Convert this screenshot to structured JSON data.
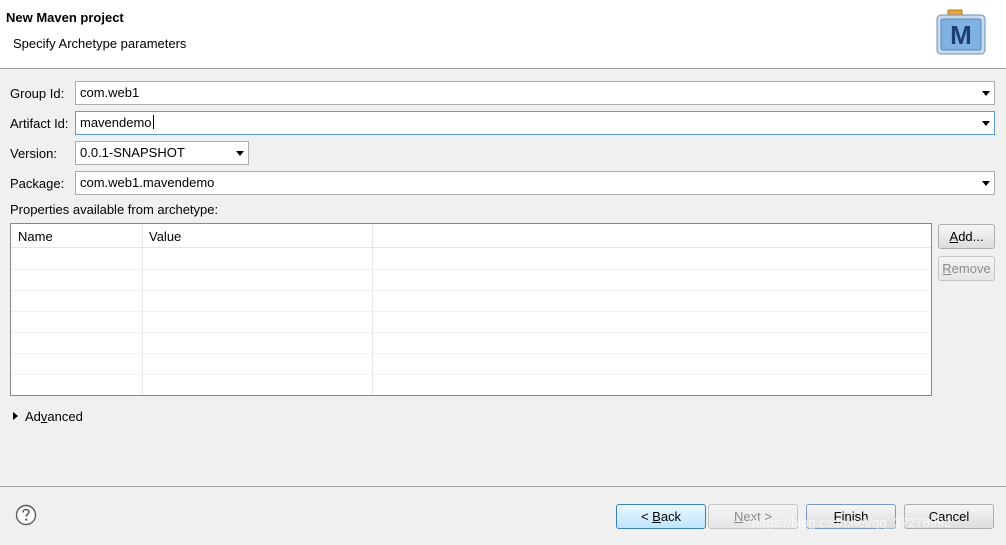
{
  "header": {
    "title": "New Maven project",
    "description": "Specify Archetype parameters",
    "logo_icon": "maven-m-icon",
    "logo_letter": "M"
  },
  "form": {
    "group_id": {
      "label": "Group Id:",
      "value": "com.web1"
    },
    "artifact_id": {
      "label": "Artifact Id:",
      "value": "mavendemo"
    },
    "version": {
      "label": "Version:",
      "value": "0.0.1-SNAPSHOT"
    },
    "package": {
      "label": "Package:",
      "value": "com.web1.mavendemo"
    }
  },
  "properties": {
    "label": "Properties available from archetype:",
    "columns": [
      "Name",
      "Value"
    ],
    "rows": [],
    "add_button": {
      "text": "dd...",
      "mnemonic": "A"
    },
    "remove_button": {
      "text": "emove",
      "mnemonic": "R"
    }
  },
  "advanced": {
    "text_before": "Ad",
    "mnemonic": "v",
    "text_after": "anced"
  },
  "footer": {
    "help_icon": "help-icon",
    "back_button": {
      "prefix": "< ",
      "mnemonic": "B",
      "text": "ack"
    },
    "next_button": {
      "mnemonic": "N",
      "text": "ext >"
    },
    "finish_button": {
      "mnemonic": "F",
      "text": "inish"
    },
    "cancel_button": {
      "text": "Cancel"
    }
  },
  "watermark": "https://blog.csdn.net/qq_37278992",
  "colors": {
    "focus_border": "#5b9bd5",
    "default_button": "#3c7fb1"
  }
}
